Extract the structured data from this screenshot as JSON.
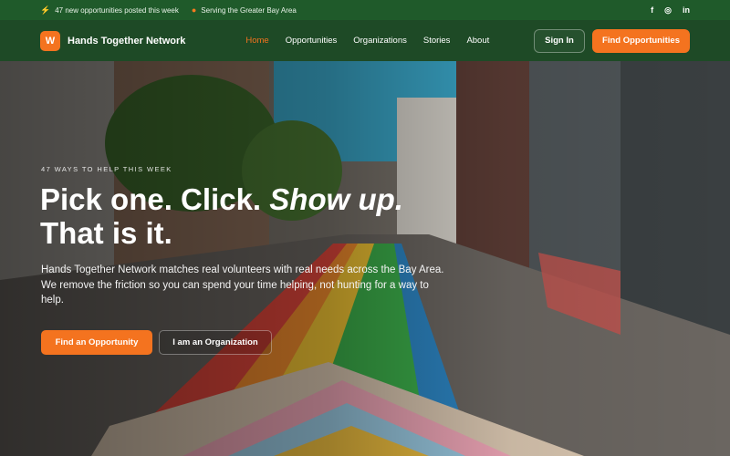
{
  "topbar": {
    "announcement": "47 new opportunities posted this week",
    "announcement_icon": "bolt-icon",
    "location": "Serving the Greater Bay Area",
    "location_icon": "map-pin-icon",
    "social": [
      "f",
      "◎",
      "in"
    ]
  },
  "nav": {
    "logo_glyph": "W",
    "brand": "Hands Together Network",
    "links": [
      "Home",
      "Opportunities",
      "Organizations",
      "Stories",
      "About"
    ],
    "active": "Home",
    "signin": "Sign In",
    "cta": "Find Opportunities"
  },
  "hero": {
    "eyebrow": "47 WAYS TO HELP THIS WEEK",
    "title_1": "Pick one. Click.",
    "title_em": "Show up.",
    "title_2": "That is it.",
    "subtitle": "Hands Together Network matches real volunteers with real needs across the Bay Area. We remove the friction so you can spend your time helping, not hunting for a way to help.",
    "primary_button": "Find an Opportunity",
    "secondary_button": "I am an Organization"
  },
  "colors": {
    "accent": "#f4731f",
    "topbar_bg": "#1f5a2a",
    "nav_bg": "#1e4a26"
  }
}
